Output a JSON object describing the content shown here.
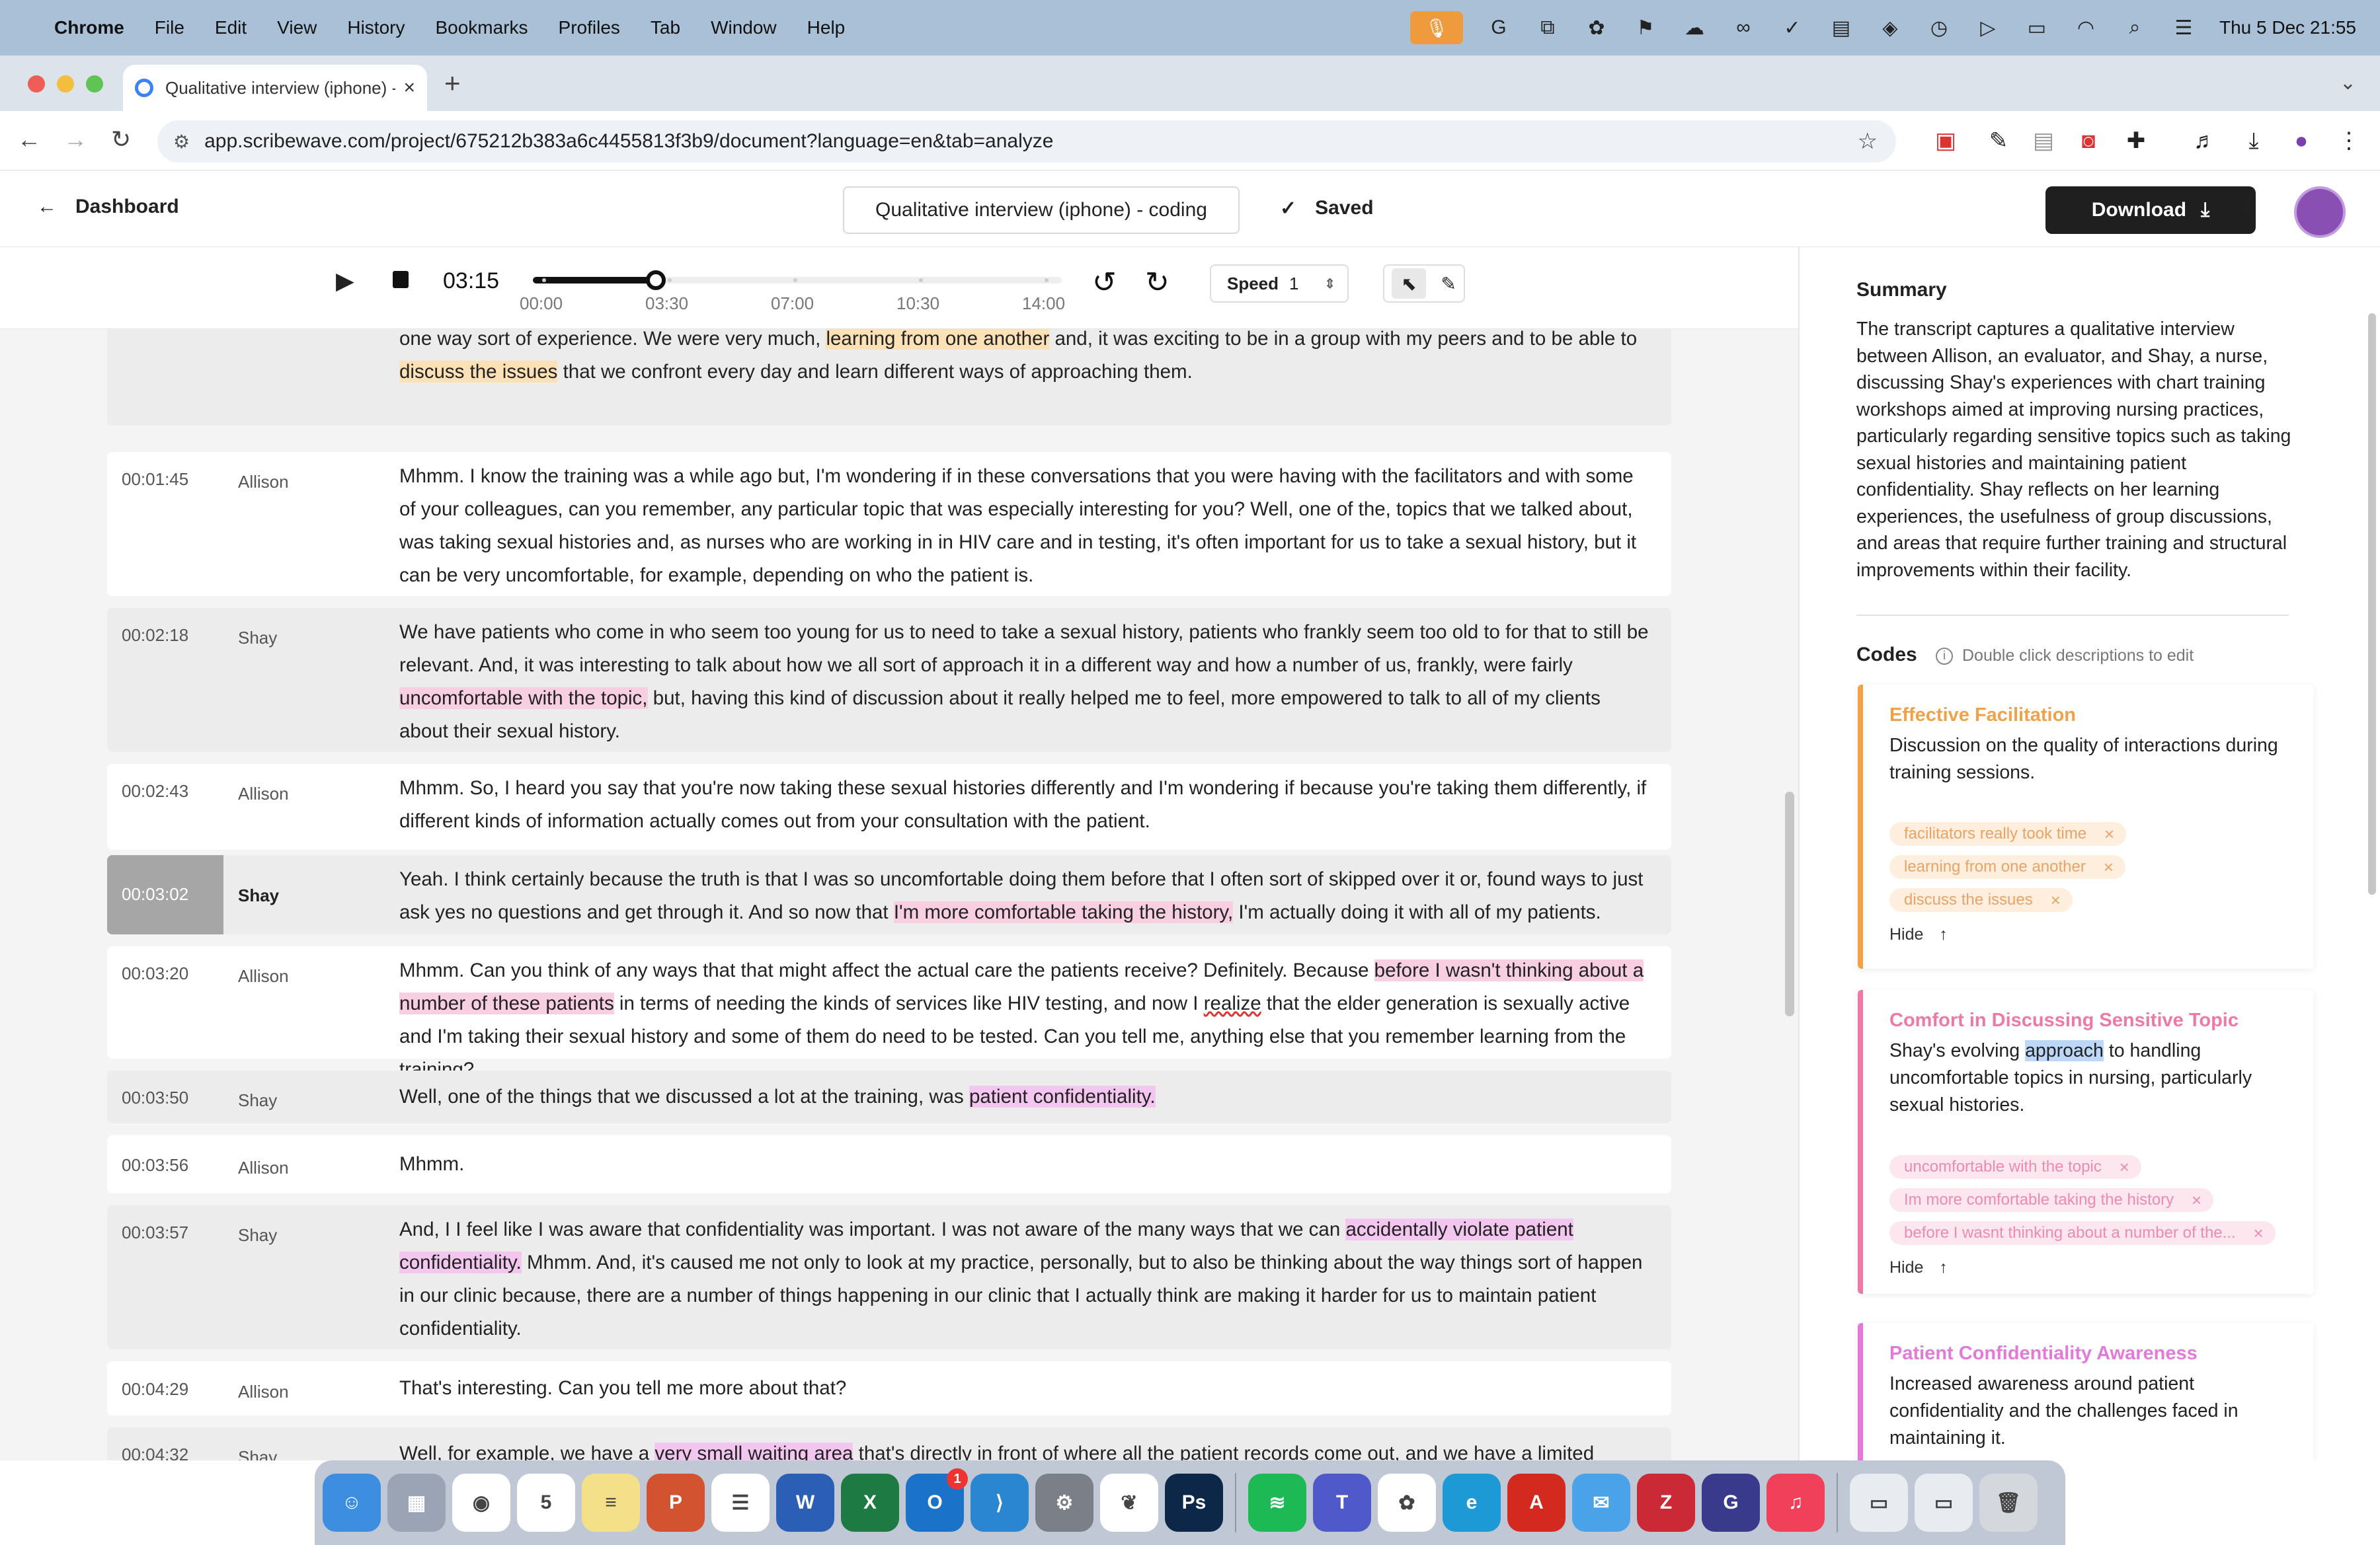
{
  "menubar": {
    "app": "Chrome",
    "items": [
      "File",
      "Edit",
      "View",
      "History",
      "Bookmarks",
      "Profiles",
      "Tab",
      "Window",
      "Help"
    ],
    "clock": "Thu 5 Dec  21:55"
  },
  "browser": {
    "tab_title": "Qualitative interview (iphone) - coding",
    "url": "app.scribewave.com/project/675212b383a6c4455813f3b9/document?language=en&tab=analyze"
  },
  "header": {
    "back_label": "Dashboard",
    "doc_title": "Qualitative interview (iphone) - coding",
    "saved_label": "Saved",
    "download_label": "Download"
  },
  "player": {
    "current_time": "03:15",
    "progress": 0.232,
    "ticks": [
      "00:00",
      "03:30",
      "07:00",
      "10:30",
      "14:00"
    ],
    "speed_label": "Speed",
    "speed_value": "1"
  },
  "transcript": {
    "rows": [
      {
        "time": "",
        "speaker": "Shay",
        "segments": [
          {
            "t": "kind of discussion that we had about a number of the the topics that we were discussing. And I felt like I wasn't just being told things. It wasn't a one way sort of experience. We were very much, "
          },
          {
            "t": "learning from one another",
            "hl": "o"
          },
          {
            "t": " and, it was exciting to be in a group with my peers and to be able to "
          },
          {
            "t": "discuss the issues",
            "hl": "o"
          },
          {
            "t": " that we confront every day and learn different ways of approaching them."
          }
        ]
      },
      {
        "time": "00:01:45",
        "speaker": "Allison",
        "segments": [
          {
            "t": "Mhmm. I know the training was a while ago but, I'm wondering if in these conversations that you were having with the facilitators and with some of your colleagues, can you remember, any particular topic that was especially interesting for you? Well, one of the, topics that we talked about, was taking sexual histories and, as nurses who are working in in HIV care and in testing, it's often important for us to take a sexual history, but it can be very uncomfortable, for example, depending on who the patient is."
          }
        ]
      },
      {
        "time": "00:02:18",
        "speaker": "Shay",
        "segments": [
          {
            "t": "We have patients who come in who seem too young for us to need to take a sexual history, patients who frankly seem too old to for that to still be relevant. And, it was interesting to talk about how we all sort of approach it in a different way and how a number of us, frankly, were fairly "
          },
          {
            "t": "uncomfortable with the topic,",
            "hl": "p"
          },
          {
            "t": " but, having this kind of discussion about it really helped me to feel, more empowered to talk to all of my clients about their sexual history."
          }
        ]
      },
      {
        "time": "00:02:43",
        "speaker": "Allison",
        "segments": [
          {
            "t": "Mhmm. So, I heard you say that you're now taking these sexual histories differently and I'm wondering if because you're taking them differently, if different kinds of information actually comes out from your consultation with the patient."
          }
        ]
      },
      {
        "time": "00:03:02",
        "speaker": "Shay",
        "segments": [
          {
            "t": "Yeah. I think certainly because the truth is that I was so uncomfortable doing them before that I often sort of skipped over it or, found ways to just ask yes no questions and get through it. And so now that "
          },
          {
            "t": "I'm more comfortable taking the history,",
            "hl": "p"
          },
          {
            "t": " I'm actually doing it with all of my patients."
          }
        ]
      },
      {
        "time": "00:03:20",
        "speaker": "Allison",
        "segments": [
          {
            "t": "Mhmm. Can you think of any ways that that might affect the actual care the patients receive? Definitely. Because "
          },
          {
            "t": "before I wasn't thinking about a number of these patients",
            "hl": "p"
          },
          {
            "t": " in terms of needing the kinds of services like HIV testing, and now I "
          },
          {
            "t": "realize",
            "hl": "w"
          },
          {
            "t": " that the elder generation is sexually active and I'm taking their sexual history and some of them do need to be tested. Can you tell me, anything else that you remember learning from the training?"
          }
        ]
      },
      {
        "time": "00:03:50",
        "speaker": "Shay",
        "segments": [
          {
            "t": "Well, one of the things that we discussed a lot at the training, was "
          },
          {
            "t": "patient confidentiality.",
            "hl": "v"
          }
        ]
      },
      {
        "time": "00:03:56",
        "speaker": "Allison",
        "segments": [
          {
            "t": "Mhmm."
          }
        ]
      },
      {
        "time": "00:03:57",
        "speaker": "Shay",
        "segments": [
          {
            "t": "And, I I feel like I was aware that confidentiality was important. I was not aware of the many ways that we can "
          },
          {
            "t": "accidentally violate patient confidentiality.",
            "hl": "v"
          },
          {
            "t": " Mhmm. And, it's caused me not only to look at my practice, personally, but to also be thinking about the way things sort of happen in our clinic because, there are a number of things happening in our clinic that I actually think are making it harder for us to maintain patient confidentiality."
          }
        ]
      },
      {
        "time": "00:04:29",
        "speaker": "Allison",
        "segments": [
          {
            "t": "That's interesting. Can you tell me more about that?"
          }
        ]
      },
      {
        "time": "00:04:32",
        "speaker": "Shay",
        "segments": [
          {
            "t": "Well, for example, we have a "
          },
          {
            "t": "very small waiting area",
            "hl": "v"
          },
          {
            "t": " that's directly in front of where all the patient records come out, and we have a limited number"
          }
        ]
      }
    ]
  },
  "panel": {
    "summary_title": "Summary",
    "summary_text": "The transcript captures a qualitative interview between Allison, an evaluator, and Shay, a nurse, discussing Shay's experiences with chart training workshops aimed at improving nursing practices, particularly regarding sensitive topics such as taking sexual histories and maintaining patient confidentiality. Shay reflects on her learning experiences, the usefulness of group discussions, and areas that require further training and structural improvements within their facility.",
    "codes_title": "Codes",
    "codes_hint": "Double click descriptions to edit",
    "hide_label": "Hide",
    "codes": [
      {
        "name": "Effective Facilitation",
        "color": "#f0a24a",
        "chip_bg": "#fdeede",
        "chip_fg": "#e8a467",
        "desc": "Discussion on the quality of interactions during training sessions.",
        "tags": [
          "facilitators really took time",
          "learning from one another",
          "discuss the issues"
        ]
      },
      {
        "name": "Comfort in Discussing Sensitive Topic",
        "color": "#ec7aa5",
        "chip_bg": "#fde7ef",
        "chip_fg": "#ec8ab0",
        "desc_pre": "Shay's evolving ",
        "desc_sel": "approach",
        "desc_post": " to handling uncomfortable topics in nursing, particularly sexual histories.",
        "tags": [
          "uncomfortable with the topic",
          "Im more comfortable taking the history",
          "before I wasnt thinking about a number of the..."
        ]
      },
      {
        "name": "Patient Confidentiality Awareness",
        "color": "#e37ad9",
        "chip_bg": "#fbe3f8",
        "chip_fg": "#e087d8",
        "desc": "Increased awareness around patient confidentiality and the challenges faced in maintaining it.",
        "tags": []
      }
    ]
  },
  "dock": {
    "apps": [
      {
        "name": "Finder",
        "color": "#3d8de0",
        "glyph": "☺"
      },
      {
        "name": "Launchpad",
        "color": "#9aa4b5",
        "glyph": "▦"
      },
      {
        "name": "Chrome",
        "color": "#ffffff",
        "glyph": "◉"
      },
      {
        "name": "Calendar",
        "color": "#ffffff",
        "glyph": "5"
      },
      {
        "name": "Notes",
        "color": "#f5e08a",
        "glyph": "≡"
      },
      {
        "name": "PowerPoint",
        "color": "#d35230",
        "glyph": "P"
      },
      {
        "name": "Reminders",
        "color": "#ffffff",
        "glyph": "☰"
      },
      {
        "name": "Word",
        "color": "#2b5fb5",
        "glyph": "W"
      },
      {
        "name": "Excel",
        "color": "#1d7a43",
        "glyph": "X"
      },
      {
        "name": "Outlook",
        "color": "#1a73c9",
        "glyph": "O",
        "badge": "1"
      },
      {
        "name": "VS Code",
        "color": "#2a86d1",
        "glyph": "⟩"
      },
      {
        "name": "System Settings",
        "color": "#7a7f88",
        "glyph": "⚙"
      },
      {
        "name": "Leaf",
        "color": "#ffffff",
        "glyph": "❦"
      },
      {
        "name": "Photoshop",
        "color": "#0c2748",
        "glyph": "Ps"
      },
      {
        "name": "Spotify",
        "color": "#1db954",
        "glyph": "≋"
      },
      {
        "name": "Teams",
        "color": "#5059c9",
        "glyph": "T"
      },
      {
        "name": "ChatGPT",
        "color": "#ffffff",
        "glyph": "✿"
      },
      {
        "name": "Edge",
        "color": "#1d9ad6",
        "glyph": "e"
      },
      {
        "name": "Acrobat",
        "color": "#d4291f",
        "glyph": "A"
      },
      {
        "name": "Mail",
        "color": "#4aa2e8",
        "glyph": "✉"
      },
      {
        "name": "Zotero",
        "color": "#cc2936",
        "glyph": "Z"
      },
      {
        "name": "Grammarly",
        "color": "#3a3a8c",
        "glyph": "G"
      },
      {
        "name": "Music",
        "color": "#f0405a",
        "glyph": "♫"
      },
      {
        "name": "Preview",
        "color": "#e8ecf1",
        "glyph": "▭"
      },
      {
        "name": "Preview 2",
        "color": "#e8ecf1",
        "glyph": "▭"
      },
      {
        "name": "Trash",
        "color": "#d4d8dd",
        "glyph": "🗑"
      }
    ]
  },
  "colors": {
    "highlight_orange": "#fce0b6",
    "highlight_pink": "#f8cfe1",
    "highlight_violet": "#f2c6ee",
    "accent_dark": "#1f1f1f"
  }
}
